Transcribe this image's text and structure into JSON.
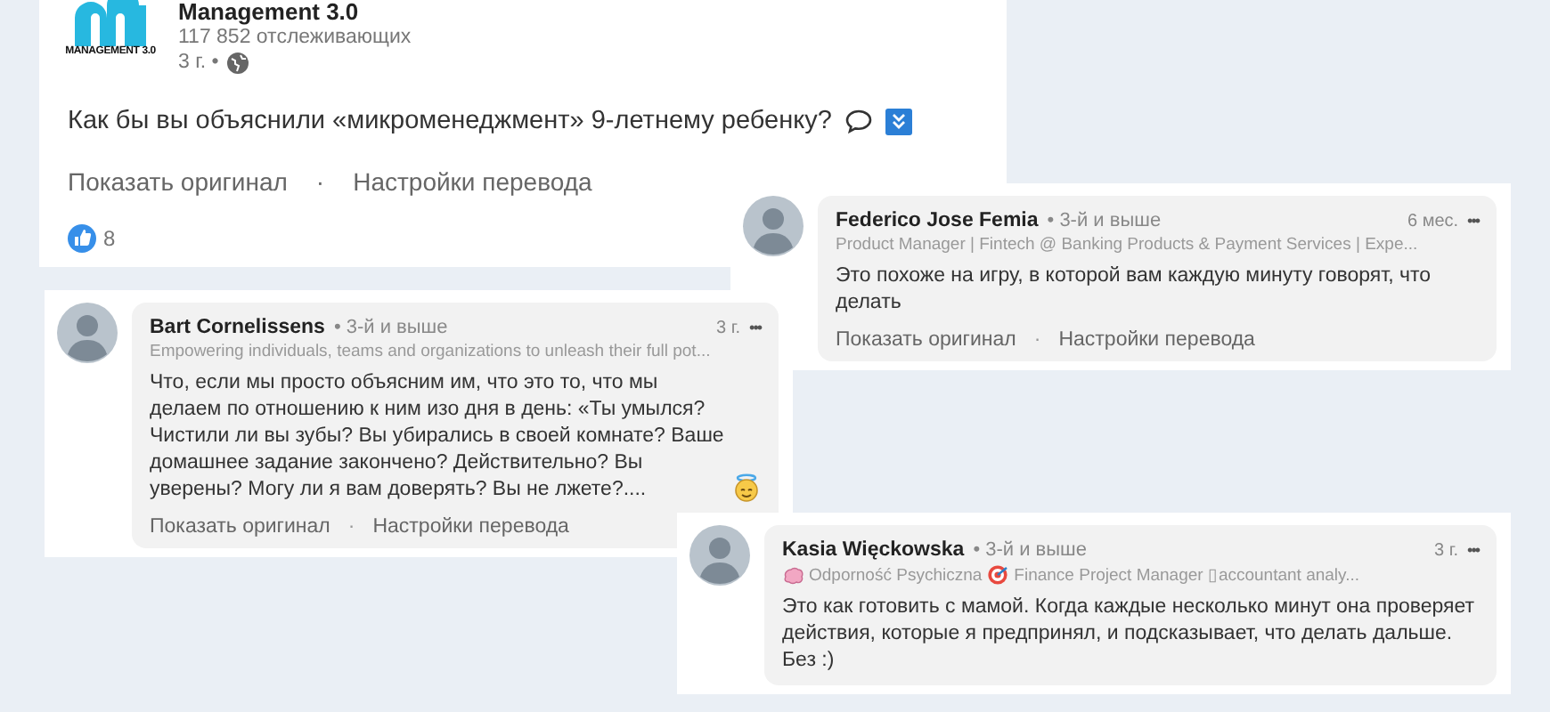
{
  "post": {
    "author": "Management 3.0",
    "logo_text": "MANAGEMENT 3.0",
    "followers": "117 852 отслеживающих",
    "time": "3 г. •",
    "text": "Как бы вы объяснили «микроменеджмент» 9-летнему ребенку?",
    "icons": [
      {
        "kind": "speech-bubble"
      },
      {
        "kind": "down-box"
      }
    ],
    "links": [
      "Показать оригинал",
      "Настройки перевода"
    ],
    "separator": "·",
    "likes": "8"
  },
  "comments": [
    {
      "name": "Federico Jose Femia",
      "degree": "• 3-й и выше",
      "time": "6 мес.",
      "menu": "•••",
      "headline": [
        {
          "kind": "text",
          "text": "Product Manager | Fintech @ Banking Products & Payment Services | Expe..."
        }
      ],
      "text": "Это похоже на игру, в которой вам каждую минуту говорят, что делать",
      "links": [
        "Показать оригинал",
        "Настройки перевода"
      ],
      "separator": "·"
    },
    {
      "name": "Bart Cornelissens",
      "degree": "• 3-й и выше",
      "time": "3 г.",
      "menu": "•••",
      "headline": [
        {
          "kind": "text",
          "text": "Empowering individuals, teams and organizations to unleash their full pot..."
        }
      ],
      "text": "Что, если мы просто объясним им, что это то, что мы делаем по отношению к ним изо дня в день: «Ты умылся? Чистили ли вы зубы? Вы убирались в своей комнате? Ваше домашнее задание закончено? Действительно? Вы уверены? Могу ли я вам доверять? Вы не лжете?....",
      "trailing_icon": {
        "kind": "halo-smiley"
      },
      "links": [
        "Показать оригинал",
        "Настройки перевода"
      ],
      "separator": "·"
    },
    {
      "name": "Kasia Więckowska",
      "degree": "• 3-й и выше",
      "time": "3 г.",
      "menu": "•••",
      "headline": [
        {
          "kind": "brain"
        },
        {
          "kind": "text",
          "text": "Odporność Psychiczna"
        },
        {
          "kind": "target"
        },
        {
          "kind": "text",
          "text": "Finance Project Manager ▯accountant analy..."
        }
      ],
      "text": "Это как готовить с мамой. Когда каждые несколько минут она проверяет действия, которые я предпринял, и подсказывает, что делать дальше. Без :)"
    }
  ]
}
